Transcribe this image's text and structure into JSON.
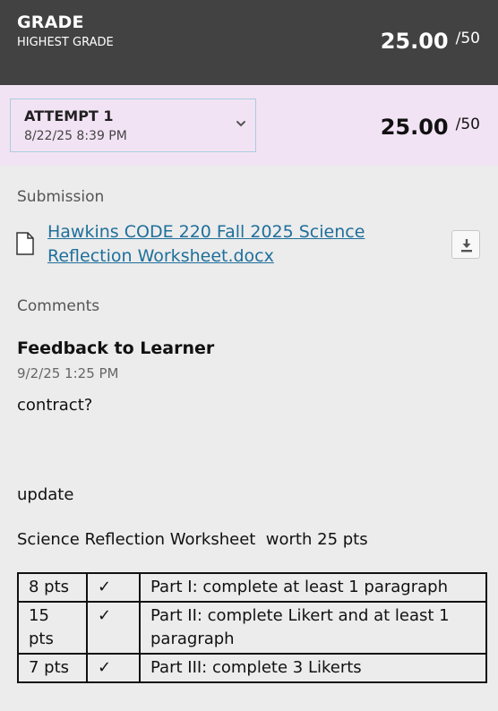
{
  "grade": {
    "title": "GRADE",
    "subtitle": "HIGHEST GRADE",
    "score": "25.00",
    "out_of": "/50"
  },
  "attempt": {
    "label": "ATTEMPT 1",
    "date": "8/22/25 8:39 PM",
    "score": "25.00",
    "out_of": "/50"
  },
  "submission": {
    "heading": "Submission",
    "file_name": "Hawkins CODE 220 Fall 2025 Science Reflection Worksheet.docx"
  },
  "comments": {
    "heading": "Comments",
    "feedback_title": "Feedback to Learner",
    "feedback_date": "9/2/25 1:25 PM",
    "line1": "contract?",
    "line2": "update",
    "line3": "Science Reflection Worksheet  worth 25 pts"
  },
  "rubric": [
    {
      "pts": "8 pts",
      "check": "✓",
      "desc": "Part I: complete at least 1 paragraph"
    },
    {
      "pts": "15 pts",
      "check": "✓",
      "desc": "Part II: complete Likert and at least 1 paragraph"
    },
    {
      "pts": "7 pts",
      "check": "✓",
      "desc": "Part III: complete 3 Likerts"
    }
  ],
  "icons": {
    "chevron": "chevron-down-icon",
    "file": "document-icon",
    "download": "download-icon"
  }
}
